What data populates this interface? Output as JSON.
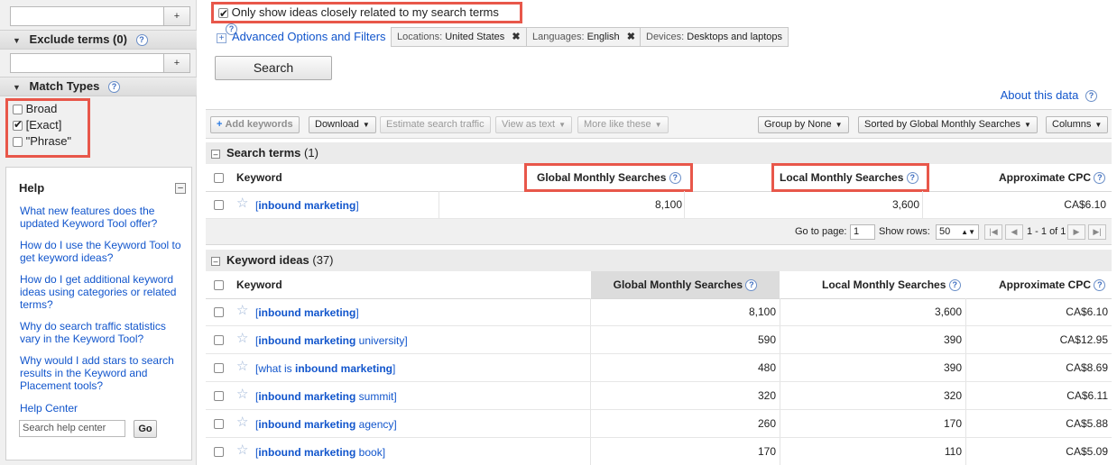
{
  "left": {
    "add_button": "+",
    "exclude_terms_label": "Exclude terms (0)",
    "exclude_add_button": "+",
    "match_types_label": "Match Types",
    "match_types": [
      {
        "label": "Broad",
        "checked": false
      },
      {
        "label": "[Exact]",
        "checked": true
      },
      {
        "label": "\"Phrase\"",
        "checked": false
      }
    ],
    "help": {
      "title": "Help",
      "collapse_glyph": "–",
      "links": [
        "What new features does the updated Keyword Tool offer?",
        "How do I use the Keyword Tool to get keyword ideas?",
        "How do I get additional keyword ideas using categories or related terms?",
        "Why do search traffic statistics vary in the Keyword Tool?",
        "Why would I add stars to search results in the Keyword and Placement tools?"
      ],
      "help_center": "Help Center",
      "search_placeholder": "Search help center",
      "go_button": "Go"
    }
  },
  "filters": {
    "only_show_label": "Only show ideas closely related to my search terms",
    "only_show_checked": true,
    "advanced_label": "Advanced Options and Filters",
    "chips": [
      {
        "key": "Locations:",
        "value": "United States",
        "close": "✖"
      },
      {
        "key": "Languages:",
        "value": "English",
        "close": "✖"
      },
      {
        "key": "Devices:",
        "value": "Desktops and laptops"
      }
    ],
    "search_button": "Search",
    "about_link": "About this data"
  },
  "toolbar": {
    "add_keywords": "Add keywords",
    "download": "Download",
    "estimate": "Estimate search traffic",
    "view_as_text": "View as text",
    "more_like_these": "More like these",
    "group_by": "Group by None",
    "sorted_by": "Sorted by Global Monthly Searches",
    "columns": "Columns",
    "caret": "▼",
    "plus": "+"
  },
  "search_terms": {
    "title": "Search terms",
    "count": "(1)",
    "columns": [
      "Keyword",
      "Global Monthly Searches",
      "Local Monthly Searches",
      "Approximate CPC"
    ],
    "rows": [
      {
        "prefix": "[",
        "bold": "inbound marketing",
        "suffix": "]",
        "global": "8,100",
        "local": "3,600",
        "cpc": "CA$6.10"
      }
    ]
  },
  "pager": {
    "go_to_page": "Go to page:",
    "page_value": "1",
    "show_rows": "Show rows:",
    "rows_value": "50",
    "range": "1 - 1 of 1",
    "first": "|◀",
    "prev": "◀",
    "next": "▶",
    "last": "▶|"
  },
  "keyword_ideas": {
    "title": "Keyword ideas",
    "count": "(37)",
    "columns": [
      "Keyword",
      "Global Monthly Searches",
      "Local Monthly Searches",
      "Approximate CPC"
    ],
    "rows": [
      {
        "prefix": "[",
        "bold": "inbound marketing",
        "suffix": "]",
        "global": "8,100",
        "local": "3,600",
        "cpc": "CA$6.10"
      },
      {
        "prefix": "[",
        "bold": "inbound marketing",
        "suffix": " university]",
        "global": "590",
        "local": "390",
        "cpc": "CA$12.95"
      },
      {
        "prefix": "[what is ",
        "bold": "inbound marketing",
        "suffix": "]",
        "global": "480",
        "local": "390",
        "cpc": "CA$8.69"
      },
      {
        "prefix": "[",
        "bold": "inbound marketing",
        "suffix": " summit]",
        "global": "320",
        "local": "320",
        "cpc": "CA$6.11"
      },
      {
        "prefix": "[",
        "bold": "inbound marketing",
        "suffix": " agency]",
        "global": "260",
        "local": "170",
        "cpc": "CA$5.88"
      },
      {
        "prefix": "[",
        "bold": "inbound marketing",
        "suffix": " book]",
        "global": "170",
        "local": "110",
        "cpc": "CA$5.09"
      }
    ]
  },
  "colors": {
    "highlight": "#e8574a",
    "link": "#1155cc"
  }
}
